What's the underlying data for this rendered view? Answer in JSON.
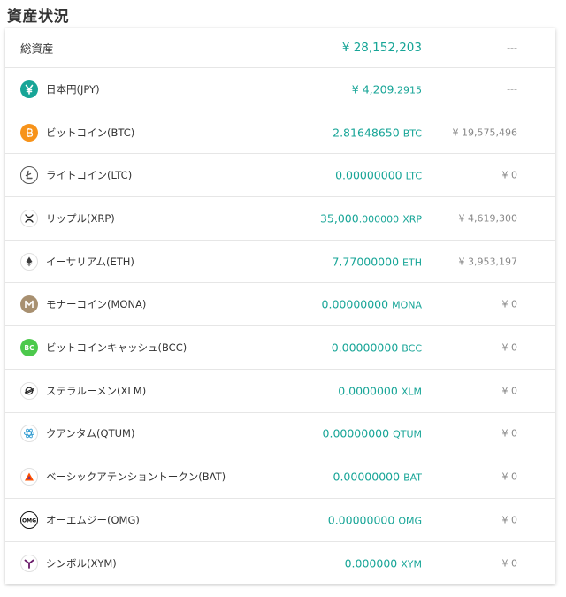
{
  "title": "資産状況",
  "total": {
    "label": "総資産",
    "amount": "¥ 28,152,203",
    "jpy": "---"
  },
  "assets": [
    {
      "icon": "yen-icon",
      "color": "#17a597",
      "name": "日本円(JPY)",
      "main": "¥ 4,209",
      "sub": ".2915",
      "unit": "",
      "jpy": "---"
    },
    {
      "icon": "bitcoin-icon",
      "color": "#f7931a",
      "name": "ビットコイン(BTC)",
      "main": "2.81648650",
      "sub": "",
      "unit": "BTC",
      "jpy": "¥ 19,575,496"
    },
    {
      "icon": "litecoin-icon",
      "color": "#555555",
      "name": "ライトコイン(LTC)",
      "main": "0.00000000",
      "sub": "",
      "unit": "LTC",
      "jpy": "¥ 0"
    },
    {
      "icon": "ripple-icon",
      "color": "#222222",
      "name": "リップル(XRP)",
      "main": "35,000",
      "sub": ".000000",
      "unit": "XRP",
      "jpy": "¥ 4,619,300"
    },
    {
      "icon": "ethereum-icon",
      "color": "#3c3c3d",
      "name": "イーサリアム(ETH)",
      "main": "7.77000000",
      "sub": "",
      "unit": "ETH",
      "jpy": "¥ 3,953,197"
    },
    {
      "icon": "monacoin-icon",
      "color": "#a89070",
      "name": "モナーコイン(MONA)",
      "main": "0.00000000",
      "sub": "",
      "unit": "MONA",
      "jpy": "¥ 0"
    },
    {
      "icon": "bitcoin-cash-icon",
      "color": "#4cc94c",
      "name": "ビットコインキャッシュ(BCC)",
      "main": "0.00000000",
      "sub": "",
      "unit": "BCC",
      "jpy": "¥ 0"
    },
    {
      "icon": "stellar-icon",
      "color": "#222222",
      "name": "ステラルーメン(XLM)",
      "main": "0.0000000",
      "sub": "",
      "unit": "XLM",
      "jpy": "¥ 0"
    },
    {
      "icon": "qtum-icon",
      "color": "#2e9ad0",
      "name": "クアンタム(QTUM)",
      "main": "0.00000000",
      "sub": "",
      "unit": "QTUM",
      "jpy": "¥ 0"
    },
    {
      "icon": "bat-icon",
      "color": "#ff5000",
      "name": "ベーシックアテンショントークン(BAT)",
      "main": "0.00000000",
      "sub": "",
      "unit": "BAT",
      "jpy": "¥ 0"
    },
    {
      "icon": "omg-icon",
      "color": "#101010",
      "name": "オーエムジー(OMG)",
      "main": "0.00000000",
      "sub": "",
      "unit": "OMG",
      "jpy": "¥ 0"
    },
    {
      "icon": "symbol-icon",
      "color": "#6a1b6a",
      "name": "シンボル(XYM)",
      "main": "0.000000",
      "sub": "",
      "unit": "XYM",
      "jpy": "¥ 0"
    }
  ]
}
